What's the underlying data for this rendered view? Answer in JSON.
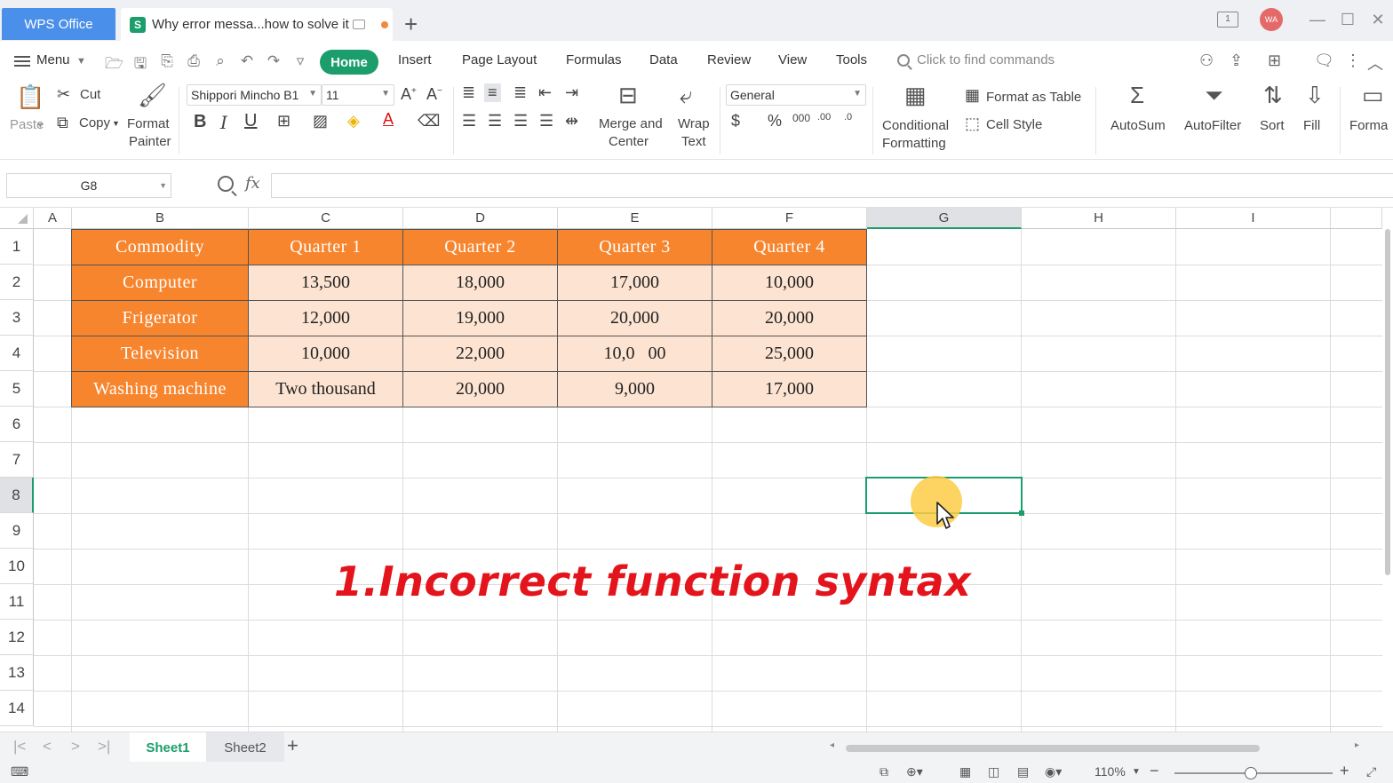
{
  "titlebar": {
    "app_tab": "WPS Office",
    "doc_tab": "Why error messa...how to solve it",
    "doc_icon": "S",
    "avatar": "WA",
    "page_badge": "1"
  },
  "menu": {
    "menu_label": "Menu",
    "tabs": [
      "Home",
      "Insert",
      "Page Layout",
      "Formulas",
      "Data",
      "Review",
      "View",
      "Tools"
    ],
    "search_placeholder": "Click to find commands"
  },
  "ribbon": {
    "paste": "Paste",
    "cut": "Cut",
    "copy": "Copy",
    "format_painter_1": "Format",
    "format_painter_2": "Painter",
    "font_name": "Shippori Mincho B1",
    "font_size": "11",
    "merge_1": "Merge and",
    "merge_2": "Center",
    "wrap_1": "Wrap",
    "wrap_2": "Text",
    "number_format": "General",
    "cond_1": "Conditional",
    "cond_2": "Formatting",
    "format_as_table": "Format as Table",
    "cell_style": "Cell Style",
    "autosum": "AutoSum",
    "autofilter": "AutoFilter",
    "sort": "Sort",
    "fill": "Fill",
    "format": "Forma"
  },
  "formula_bar": {
    "name_box": "G8",
    "fx": "fx",
    "formula": ""
  },
  "grid": {
    "columns": [
      "A",
      "B",
      "C",
      "D",
      "E",
      "F",
      "G",
      "H",
      "I"
    ],
    "rows": [
      "1",
      "2",
      "3",
      "4",
      "5",
      "6",
      "7",
      "8",
      "9",
      "10",
      "11",
      "12",
      "13",
      "14"
    ],
    "selected_cell": "G8",
    "header": [
      "Commodity",
      "Quarter 1",
      "Quarter 2",
      "Quarter 3",
      "Quarter 4"
    ],
    "data": [
      [
        "Computer",
        "13,500",
        "18,000",
        "17,000",
        "10,000"
      ],
      [
        "Frigerator",
        "12,000",
        "19,000",
        "20,000",
        "20,000"
      ],
      [
        "Television",
        "10,000",
        "22,000",
        "10,0   00",
        "25,000"
      ],
      [
        "Washing machine",
        "Two thousand",
        "20,000",
        "9,000",
        "17,000"
      ]
    ],
    "colors": {
      "header_fill": "#f7852e",
      "value_fill": "#fde3d1",
      "selection": "#1b9d6c"
    }
  },
  "overlay": {
    "caption": "1.Incorrect function syntax",
    "color": "#e3141b"
  },
  "sheets": {
    "tabs": [
      "Sheet1",
      "Sheet2"
    ],
    "active": "Sheet1",
    "add": "+"
  },
  "status": {
    "zoom": "110%"
  }
}
